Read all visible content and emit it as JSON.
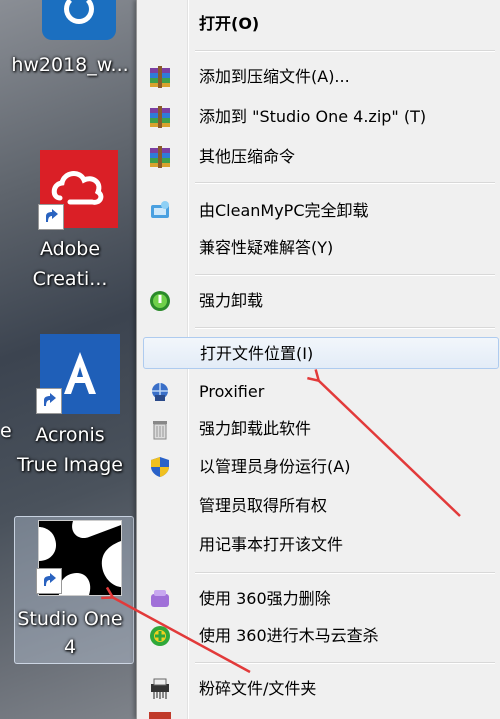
{
  "desktop": {
    "icons": [
      {
        "label": "hw2018_w..."
      },
      {
        "label1": "Adobe",
        "label2": "Creati..."
      },
      {
        "label1": "Acronis",
        "label2": "True Image"
      },
      {
        "label1": "Studio One",
        "label2": "4"
      }
    ],
    "left_edge_text": "e"
  },
  "menu": {
    "items": [
      {
        "label": "打开(O)",
        "icon": "none"
      },
      {
        "label": "添加到压缩文件(A)...",
        "icon": "winrar-icon"
      },
      {
        "label": "添加到 \"Studio One 4.zip\" (T)",
        "icon": "winrar-icon"
      },
      {
        "label": "其他压缩命令",
        "icon": "winrar-icon"
      },
      {
        "label": "由CleanMyPC完全卸载",
        "icon": "cleanmypc-icon"
      },
      {
        "label": "兼容性疑难解答(Y)",
        "icon": "none"
      },
      {
        "label": "强力卸载",
        "icon": "uninstall-icon"
      },
      {
        "label": "打开文件位置(I)",
        "icon": "none"
      },
      {
        "label": "Proxifier",
        "icon": "proxifier-icon"
      },
      {
        "label": "强力卸载此软件",
        "icon": "trash-icon"
      },
      {
        "label": "以管理员身份运行(A)",
        "icon": "shield-icon"
      },
      {
        "label": "管理员取得所有权",
        "icon": "none"
      },
      {
        "label": "用记事本打开该文件",
        "icon": "none"
      },
      {
        "label": "使用 360强力删除",
        "icon": "360-delete-icon"
      },
      {
        "label": "使用 360进行木马云查杀",
        "icon": "360-scan-icon"
      },
      {
        "label": "粉碎文件/文件夹",
        "icon": "shredder-icon"
      }
    ]
  },
  "colors": {
    "menu_bg": "#f0f0f0",
    "hover_border": "#aecbef",
    "arrow": "#e23a3a",
    "adobe_red": "#da1f26",
    "acronis_blue": "#1f5fb8"
  }
}
